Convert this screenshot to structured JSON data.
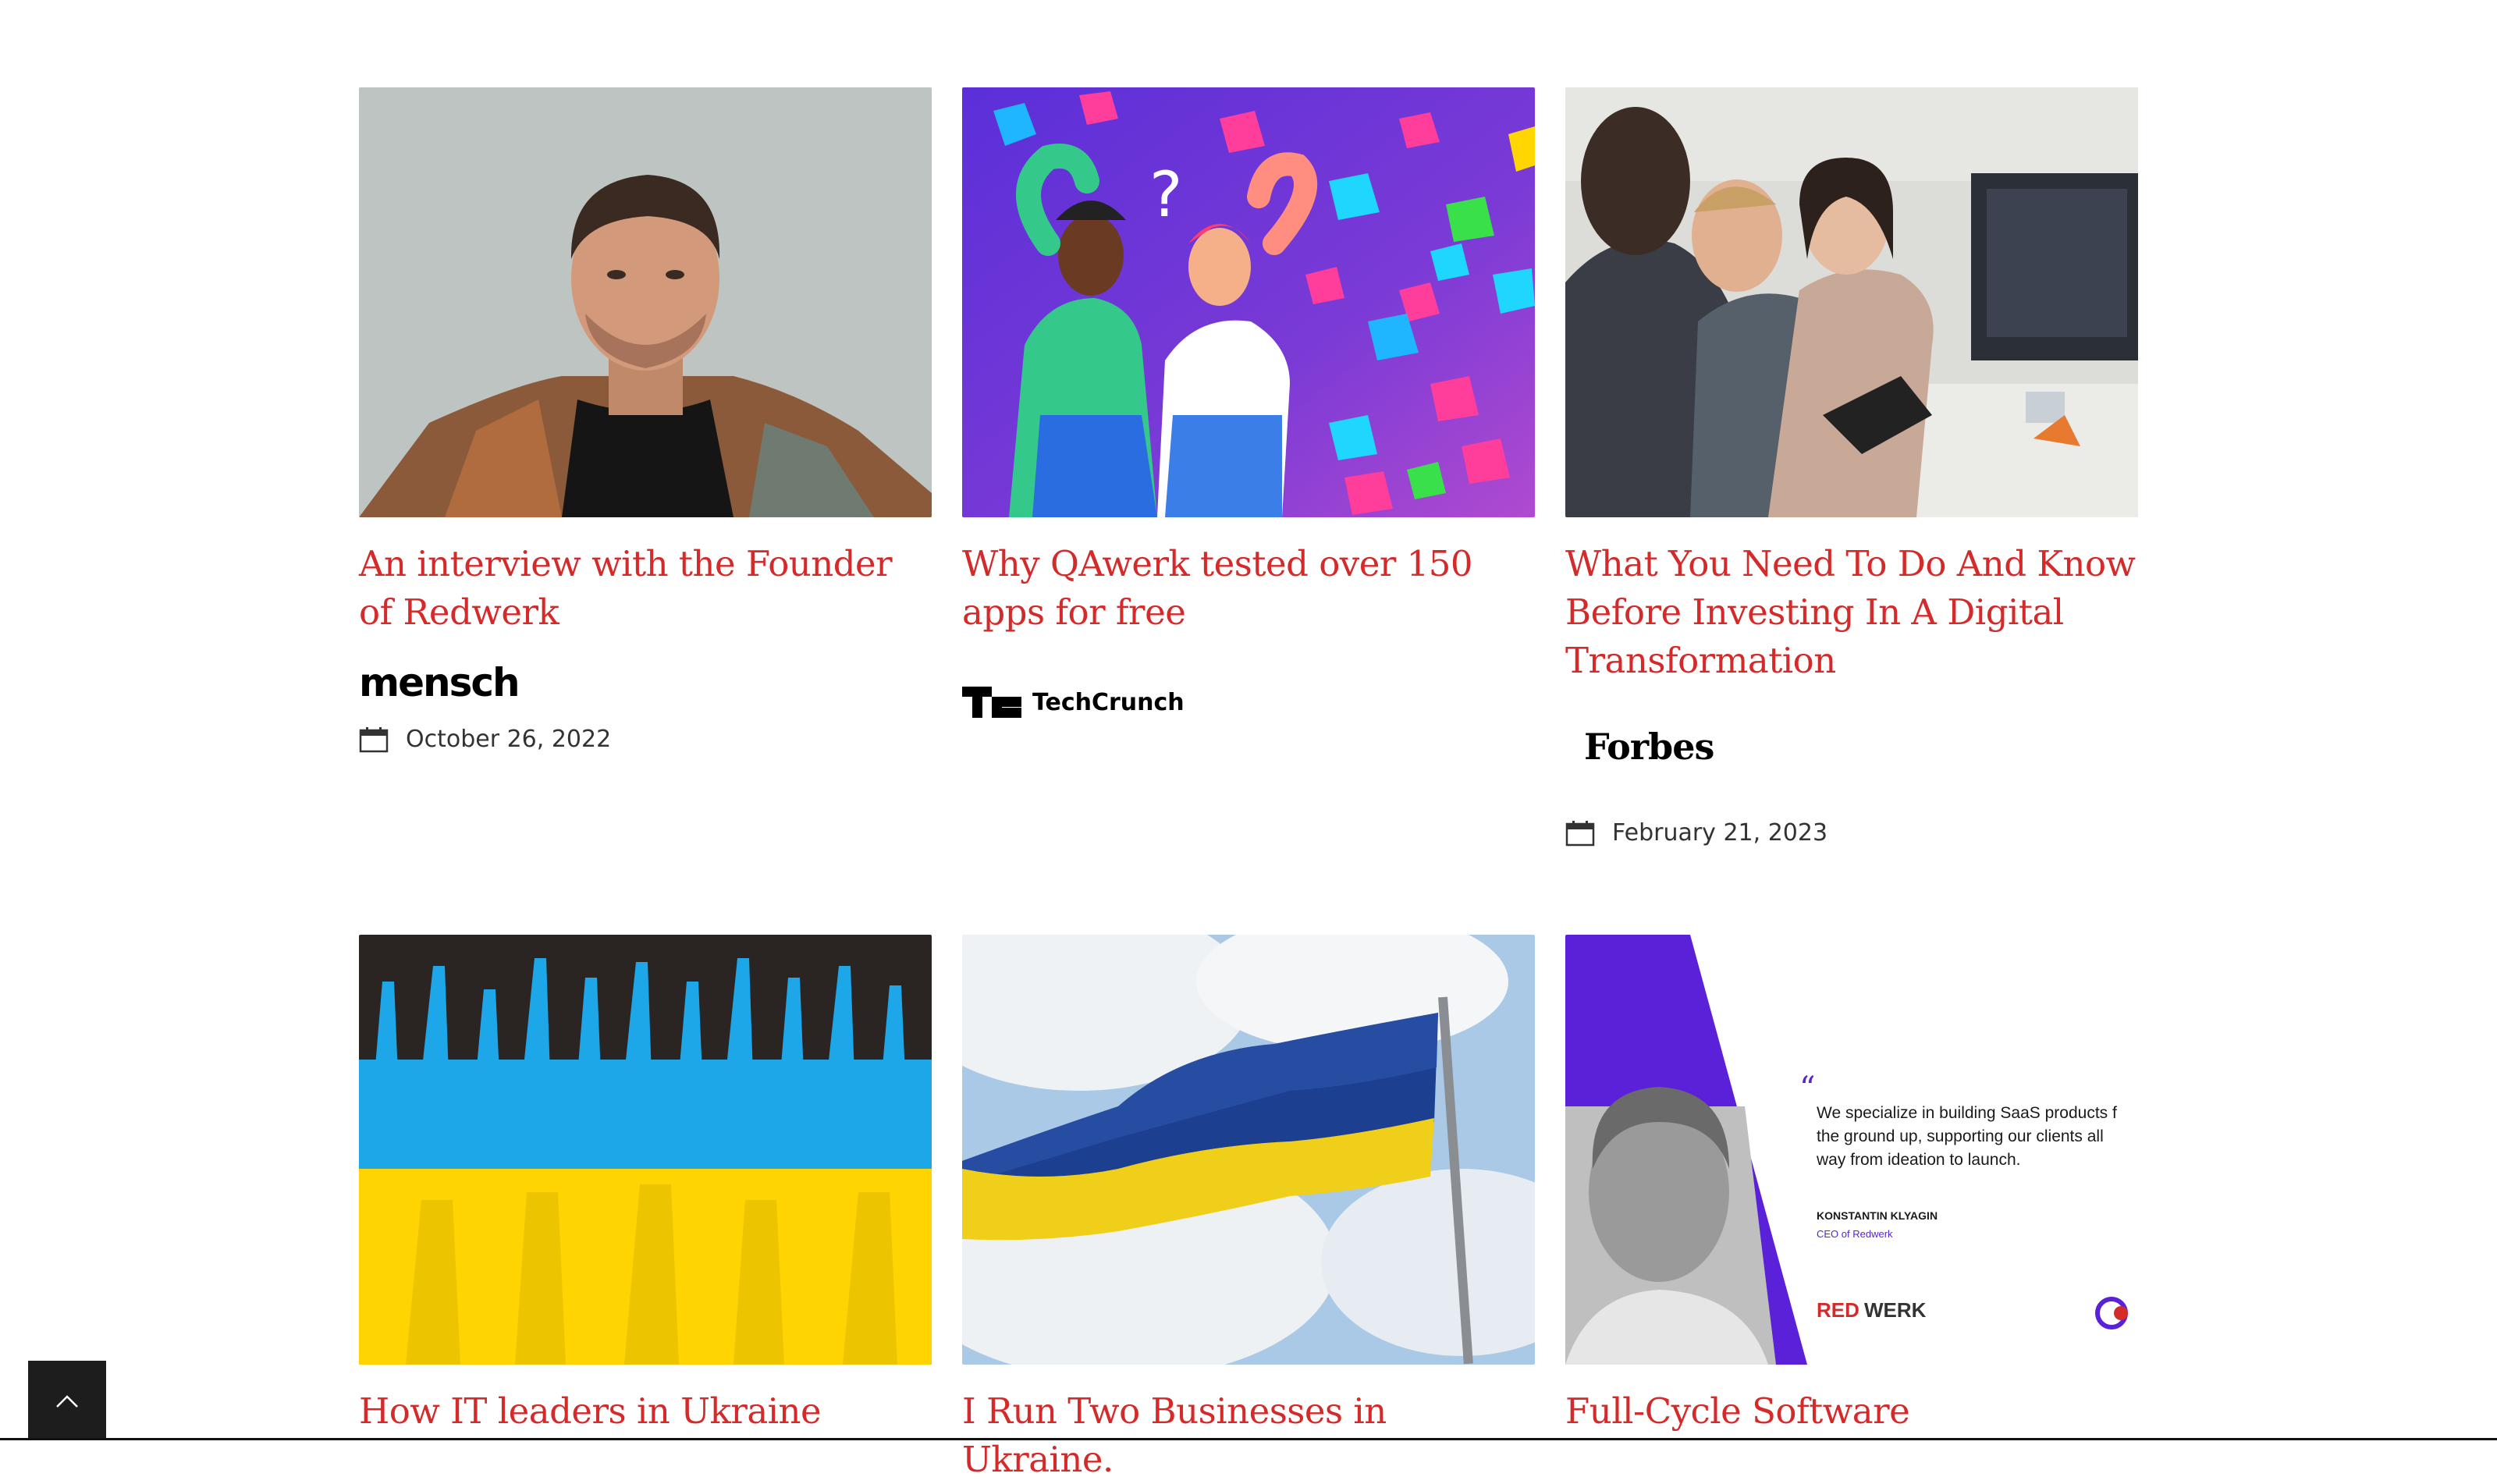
{
  "articles": [
    {
      "title": "An interview with the Founder of Redwerk",
      "source": "mensch",
      "date": "October 26, 2022"
    },
    {
      "title": "Why QAwerk tested over 150 apps for free",
      "source": "TechCrunch",
      "date": ""
    },
    {
      "title": "What You Need To Do And Know Before Investing In A Digital Transformation",
      "source": "Forbes",
      "date": "February 21, 2023"
    },
    {
      "title": "How IT leaders in Ukraine",
      "image": {
        "quote": "We specialize in building SaaS products f the ground up, supporting our clients all way from ideation to launch."
      }
    },
    {
      "title": "I Run Two Businesses in Ukraine."
    },
    {
      "title": "Full-Cycle Software",
      "image": {
        "quote_lines": [
          "We specialize in building SaaS products f",
          "the ground up, supporting our clients all",
          "way from ideation to launch."
        ],
        "person_name": "KONSTANTIN KLYAGIN",
        "person_role": "CEO of Redwerk",
        "brand_red": "RED",
        "brand_dark": "WERK"
      }
    }
  ],
  "colors": {
    "title": "#d42a2a",
    "purple": "#6b2bd9",
    "dark_button": "#1d1d1d"
  },
  "icons": {
    "calendar": "calendar-icon",
    "scroll_top": "chevron-up-icon"
  }
}
